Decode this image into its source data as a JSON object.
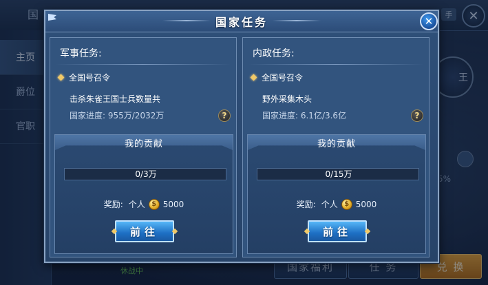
{
  "background": {
    "title_stub": "国",
    "sidebar_tabs": [
      "主页",
      "爵位",
      "官职"
    ],
    "right_badge": "王",
    "right_tab_stub": "手",
    "right_percent": "5%",
    "status_text": "休战中",
    "buttons": {
      "welfare": "国家福利",
      "task": "任 务",
      "exchange": "兑 换"
    },
    "close_symbol": "✕"
  },
  "dialog": {
    "title": "国家任务",
    "close_symbol": "✕"
  },
  "panels": [
    {
      "header": "军事任务:",
      "order_label": "全国号召令",
      "task": "击杀朱雀王国士兵数量共",
      "progress_text": "国家进度: 955万/2032万",
      "contribution": {
        "title": "我的贡献",
        "progress": "0/3万",
        "fill_percent": 0,
        "reward_label": "奖励:",
        "reward_type": "个人",
        "reward_amount": "5000",
        "button": "前往"
      }
    },
    {
      "header": "内政任务:",
      "order_label": "全国号召令",
      "task": "野外采集木头",
      "progress_text": "国家进度: 6.1亿/3.6亿",
      "contribution": {
        "title": "我的贡献",
        "progress": "0/15万",
        "fill_percent": 0,
        "reward_label": "奖励:",
        "reward_type": "个人",
        "reward_amount": "5000",
        "button": "前往"
      }
    }
  ],
  "icons": {
    "help": "?",
    "coin": "$"
  },
  "colors": {
    "dialog_bg": "#2f5079",
    "button_blue": "#1d6fc4",
    "gold": "#e5b22c",
    "exchange_orange": "#e7a53c"
  }
}
